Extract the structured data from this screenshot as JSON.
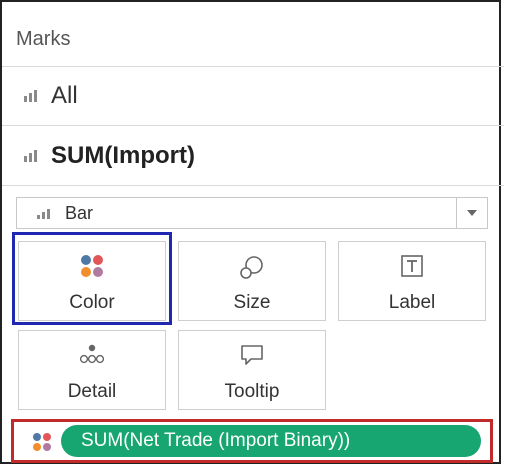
{
  "marks_panel": {
    "title": "Marks",
    "rows": [
      {
        "label": "All"
      },
      {
        "label": "SUM(Import)"
      }
    ],
    "mark_type": {
      "selected": "Bar"
    },
    "cards": [
      {
        "label": "Color",
        "icon": "color-dots-icon"
      },
      {
        "label": "Size",
        "icon": "size-bubble-icon"
      },
      {
        "label": "Label",
        "icon": "text-label-icon"
      },
      {
        "label": "Detail",
        "icon": "detail-dots-icon"
      },
      {
        "label": "Tooltip",
        "icon": "tooltip-speech-icon"
      }
    ],
    "pill": {
      "label": "SUM(Net Trade (Import Binary))",
      "color": "#17a672"
    },
    "accent_colors": {
      "selection_box": "#1f27b3",
      "highlight_box": "#c22b2b"
    }
  }
}
